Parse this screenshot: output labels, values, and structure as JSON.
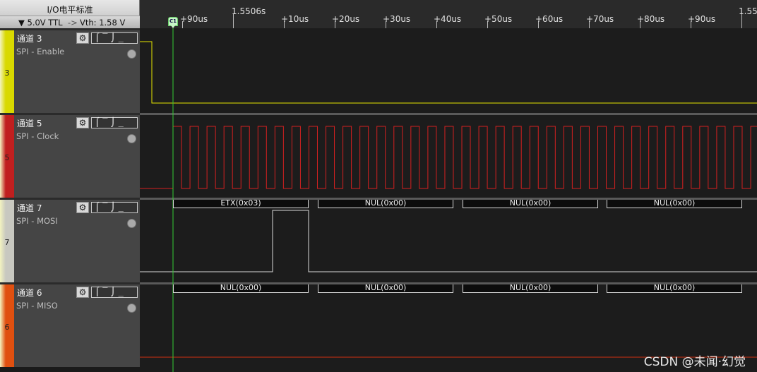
{
  "header": {
    "title": "I/O电平标准",
    "level": "▼  5.0V TTL",
    "arrow": "->",
    "vth": "Vth: 1.58 V"
  },
  "ruler": {
    "major": "1.5506s",
    "major_right": "1.55",
    "first": "+90us",
    "labels": [
      "+10us",
      "+20us",
      "+30us",
      "+40us",
      "+50us",
      "+60us",
      "+70us",
      "+80us",
      "+90us"
    ],
    "cursor": "C1"
  },
  "channels": [
    {
      "num": "3",
      "name": "通道 3",
      "desc": "SPI - Enable",
      "color": "#d9d900"
    },
    {
      "num": "5",
      "name": "通道 5",
      "desc": "SPI - Clock",
      "color": "#c01f1f"
    },
    {
      "num": "7",
      "name": "通道 7",
      "desc": "SPI - MOSI",
      "color": "#c8c8c0"
    },
    {
      "num": "6",
      "name": "通道 6",
      "desc": "SPI - MISO",
      "color": "#e05010"
    }
  ],
  "button_icons": {
    "gear": "gear-icon",
    "trigger": "trigger-edges-icon"
  },
  "trigger_glyphs": "⌠‾⌡_",
  "mosi_bytes": [
    "ETX(0x03)",
    "NUL(0x00)",
    "NUL(0x00)",
    "NUL(0x00)"
  ],
  "miso_bytes": [
    "NUL(0x00)",
    "NUL(0x00)",
    "NUL(0x00)",
    "NUL(0x00)"
  ],
  "watermark": "CSDN @未闻·幻觉",
  "colors": {
    "enable": "#e6e600",
    "clock": "#d42020",
    "mosi": "#d8d8d8",
    "miso": "#d03010",
    "cursor": "#33cc33"
  }
}
